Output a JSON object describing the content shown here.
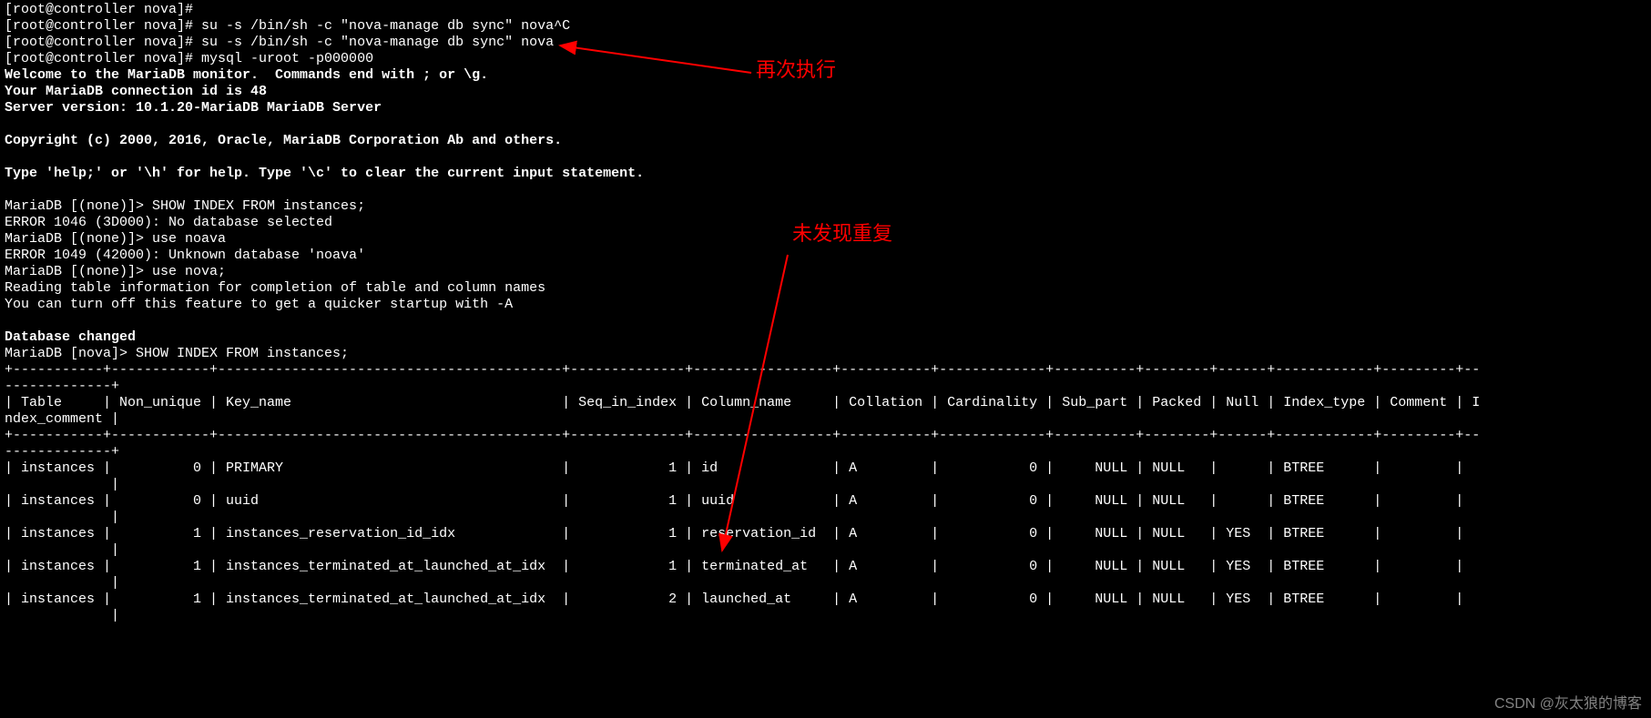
{
  "annotations": {
    "label1": "再次执行",
    "label2": "未发现重复"
  },
  "watermark": "CSDN @灰太狼的博客",
  "lines": [
    {
      "t": "[root@controller nova]#",
      "b": false
    },
    {
      "t": "[root@controller nova]# su -s /bin/sh -c \"nova-manage db sync\" nova^C",
      "b": false
    },
    {
      "t": "[root@controller nova]# su -s /bin/sh -c \"nova-manage db sync\" nova",
      "b": false
    },
    {
      "t": "[root@controller nova]# mysql -uroot -p000000",
      "b": false
    },
    {
      "t": "Welcome to the MariaDB monitor.  Commands end with ; or \\g.",
      "b": true
    },
    {
      "t": "Your MariaDB connection id is 48",
      "b": true
    },
    {
      "t": "Server version: 10.1.20-MariaDB MariaDB Server",
      "b": true
    },
    {
      "t": "",
      "b": false
    },
    {
      "t": "Copyright (c) 2000, 2016, Oracle, MariaDB Corporation Ab and others.",
      "b": true
    },
    {
      "t": "",
      "b": false
    },
    {
      "t": "Type 'help;' or '\\h' for help. Type '\\c' to clear the current input statement.",
      "b": true
    },
    {
      "t": "",
      "b": false
    },
    {
      "t": "MariaDB [(none)]> SHOW INDEX FROM instances;",
      "b": false
    },
    {
      "t": "ERROR 1046 (3D000): No database selected",
      "b": false
    },
    {
      "t": "MariaDB [(none)]> use noava",
      "b": false
    },
    {
      "t": "ERROR 1049 (42000): Unknown database 'noava'",
      "b": false
    },
    {
      "t": "MariaDB [(none)]> use nova;",
      "b": false
    },
    {
      "t": "Reading table information for completion of table and column names",
      "b": false
    },
    {
      "t": "You can turn off this feature to get a quicker startup with -A",
      "b": false
    },
    {
      "t": "",
      "b": false
    },
    {
      "t": "Database changed",
      "b": true
    },
    {
      "t": "MariaDB [nova]> SHOW INDEX FROM instances;",
      "b": false
    },
    {
      "t": "+-----------+------------+------------------------------------------+--------------+-----------------+-----------+-------------+----------+--------+------+------------+---------+---------------+",
      "b": false
    },
    {
      "t": "| Table     | Non_unique | Key_name                                 | Seq_in_index | Column_name     | Collation | Cardinality | Sub_part | Packed | Null | Index_type | Comment | Index_comment |",
      "b": false
    },
    {
      "t": "+-----------+------------+------------------------------------------+--------------+-----------------+-----------+-------------+----------+--------+------+------------+---------+---------------+",
      "b": false
    },
    {
      "t": "| instances |          0 | PRIMARY                                  |            1 | id              | A         |           0 |     NULL | NULL   |      | BTREE      |         |               |",
      "b": false
    },
    {
      "t": "| instances |          0 | uuid                                     |            1 | uuid            | A         |           0 |     NULL | NULL   |      | BTREE      |         |               |",
      "b": false
    },
    {
      "t": "| instances |          1 | instances_reservation_id_idx             |            1 | reservation_id  | A         |           0 |     NULL | NULL   | YES  | BTREE      |         |               |",
      "b": false
    },
    {
      "t": "| instances |          1 | instances_terminated_at_launched_at_idx  |            1 | terminated_at   | A         |           0 |     NULL | NULL   | YES  | BTREE      |         |               |",
      "b": false
    },
    {
      "t": "| instances |          1 | instances_terminated_at_launched_at_idx  |            2 | launched_at     | A         |           0 |     NULL | NULL   | YES  | BTREE      |         |               |",
      "b": false
    }
  ],
  "chart_data": {
    "type": "table",
    "title": "SHOW INDEX FROM instances",
    "columns": [
      "Table",
      "Non_unique",
      "Key_name",
      "Seq_in_index",
      "Column_name",
      "Collation",
      "Cardinality",
      "Sub_part",
      "Packed",
      "Null",
      "Index_type",
      "Comment",
      "Index_comment"
    ],
    "rows": [
      [
        "instances",
        0,
        "PRIMARY",
        1,
        "id",
        "A",
        0,
        "NULL",
        "NULL",
        "",
        "BTREE",
        "",
        ""
      ],
      [
        "instances",
        0,
        "uuid",
        1,
        "uuid",
        "A",
        0,
        "NULL",
        "NULL",
        "",
        "BTREE",
        "",
        ""
      ],
      [
        "instances",
        1,
        "instances_reservation_id_idx",
        1,
        "reservation_id",
        "A",
        0,
        "NULL",
        "NULL",
        "YES",
        "BTREE",
        "",
        ""
      ],
      [
        "instances",
        1,
        "instances_terminated_at_launched_at_idx",
        1,
        "terminated_at",
        "A",
        0,
        "NULL",
        "NULL",
        "YES",
        "BTREE",
        "",
        ""
      ],
      [
        "instances",
        1,
        "instances_terminated_at_launched_at_idx",
        2,
        "launched_at",
        "A",
        0,
        "NULL",
        "NULL",
        "YES",
        "BTREE",
        "",
        ""
      ]
    ]
  }
}
